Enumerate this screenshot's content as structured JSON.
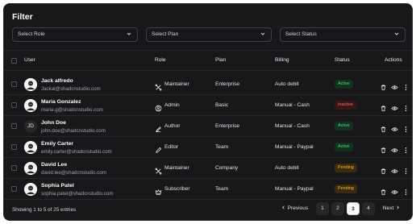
{
  "title": "Filter",
  "filters": [
    {
      "placeholder": "Select Role"
    },
    {
      "placeholder": "Select Plan"
    },
    {
      "placeholder": "Select Status"
    }
  ],
  "columns": {
    "user": "User",
    "role": "Role",
    "plan": "Plan",
    "billing": "Billing",
    "status": "Status",
    "actions": "Actions"
  },
  "rows": [
    {
      "name": "Jack alfredo",
      "email": "Jackal@shadcnstudio.com",
      "avatar": "avatar-illustration",
      "role": "Maintainer",
      "role_icon": "maintainer-icon",
      "plan": "Enterprise",
      "billing": "Auto debit",
      "status": "Active"
    },
    {
      "name": "Maria Gonzalez",
      "email": "maria.g@shadcnstudio.com",
      "avatar": "avatar-illustration",
      "role": "Admin",
      "role_icon": "admin-icon",
      "plan": "Basic",
      "billing": "Manual - Cash",
      "status": "Inactive"
    },
    {
      "name": "John Doe",
      "email": "john.doe@shadcnstudio.com",
      "avatar_initials": "JD",
      "role": "Author",
      "role_icon": "author-icon",
      "plan": "Enterprise",
      "billing": "Manual - Cash",
      "status": "Active"
    },
    {
      "name": "Emily Carter",
      "email": "emily.carter@shadcnstudio.com",
      "avatar": "avatar-illustration",
      "role": "Editor",
      "role_icon": "editor-icon",
      "plan": "Team",
      "billing": "Manual - Paypal",
      "status": "Active"
    },
    {
      "name": "David Lee",
      "email": "david.lee@shadcnstudio.com",
      "avatar": "avatar-illustration",
      "role": "Maintainer",
      "role_icon": "maintainer-icon",
      "plan": "Company",
      "billing": "Auto debit",
      "status": "Pending"
    },
    {
      "name": "Sophia Patel",
      "email": "sophia.patel@shadcnstudio.com",
      "avatar": "avatar-illustration",
      "role": "Subscriber",
      "role_icon": "subscriber-icon",
      "plan": "Team",
      "billing": "Manual - Paypal",
      "status": "Pending"
    }
  ],
  "status_colors": {
    "Active": "#4ade80",
    "Inactive": "#f87171",
    "Pending": "#fbbf24"
  },
  "row_actions": [
    "delete-icon",
    "view-icon",
    "more-vertical-icon"
  ],
  "footer": {
    "summary": "Showing 1 to 5 of 25 entries",
    "previous": "Previous",
    "pages": [
      "1",
      "2",
      "3",
      "4"
    ],
    "current_page": "3",
    "next": "Next"
  }
}
